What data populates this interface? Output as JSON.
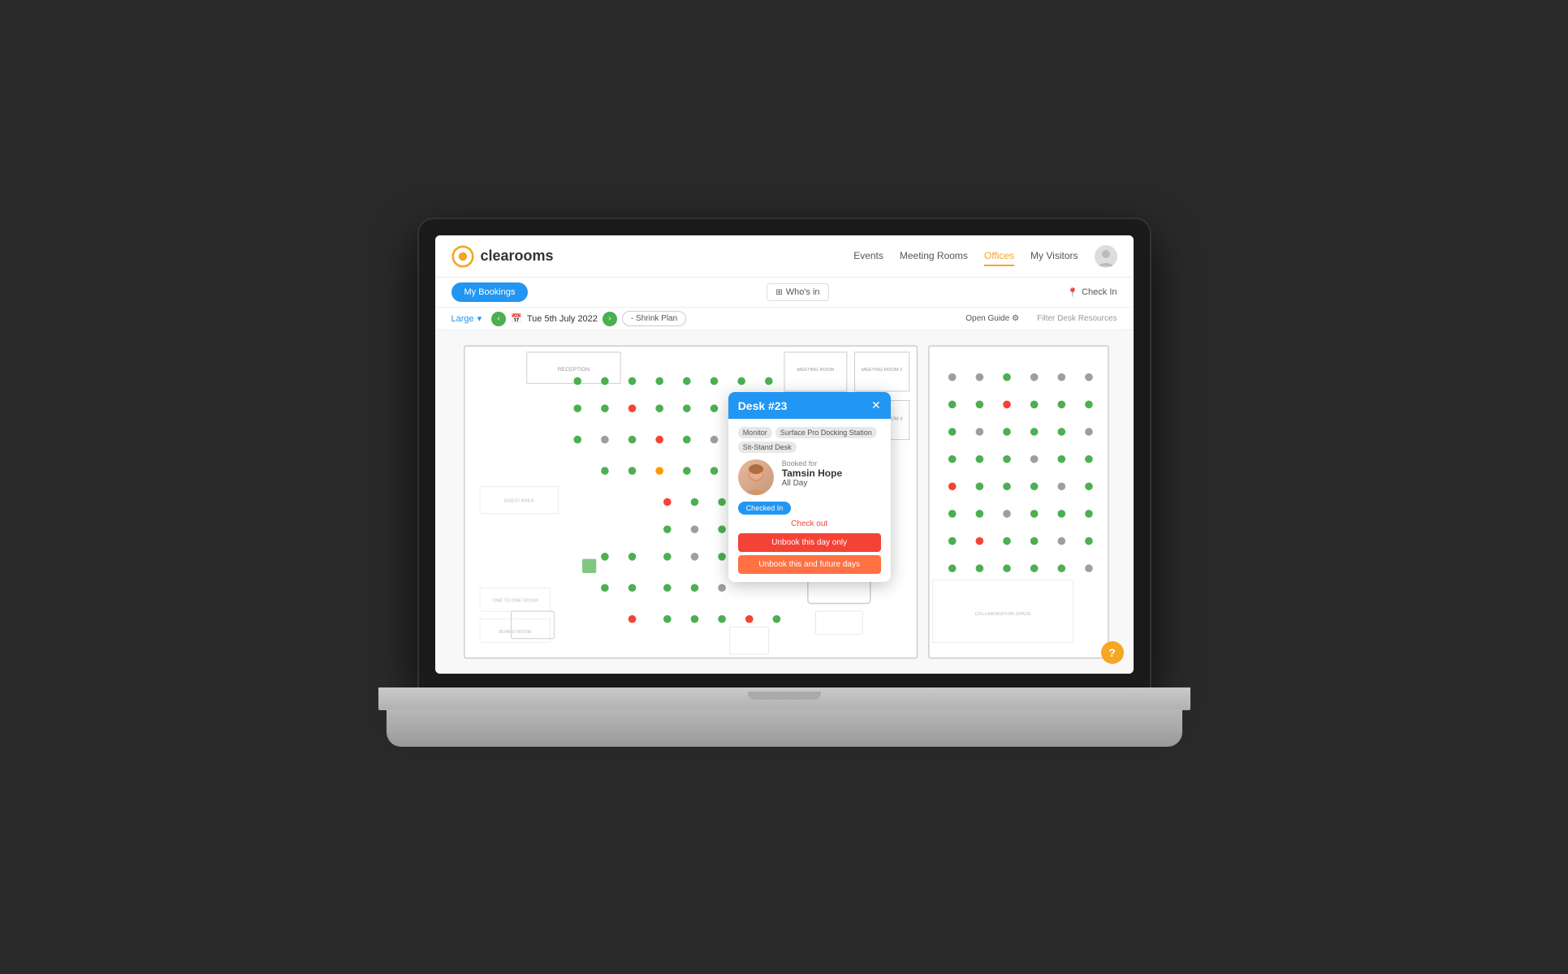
{
  "app": {
    "name": "clearooms",
    "logo_alt": "clearooms logo"
  },
  "nav": {
    "items": [
      {
        "label": "Events",
        "active": false
      },
      {
        "label": "Meeting Rooms",
        "active": false
      },
      {
        "label": "Offices",
        "active": true
      },
      {
        "label": "My Visitors",
        "active": false
      }
    ]
  },
  "toolbar": {
    "my_bookings_label": "My Bookings",
    "whos_in_label": "Who's in",
    "check_in_label": "Check In",
    "filter_desk_label": "Filter Desk Resources"
  },
  "secondary_toolbar": {
    "size_label": "Large",
    "date_label": "Tue 5th July 2022",
    "open_guide_label": "Open Guide",
    "shrink_plan_label": "- Shrink Plan"
  },
  "desk_popup": {
    "title": "Desk #23",
    "tags": [
      "Monitor",
      "Surface Pro Docking Station",
      "Sit-Stand Desk"
    ],
    "booked_for_label": "Booked for",
    "person_name": "Tamsin Hope",
    "time": "All Day",
    "checked_in_label": "Checked In",
    "checkout_label": "Check out",
    "unbook_day_label": "Unbook this day only",
    "unbook_future_label": "Unbook this and future days"
  },
  "help": {
    "label": "?"
  }
}
